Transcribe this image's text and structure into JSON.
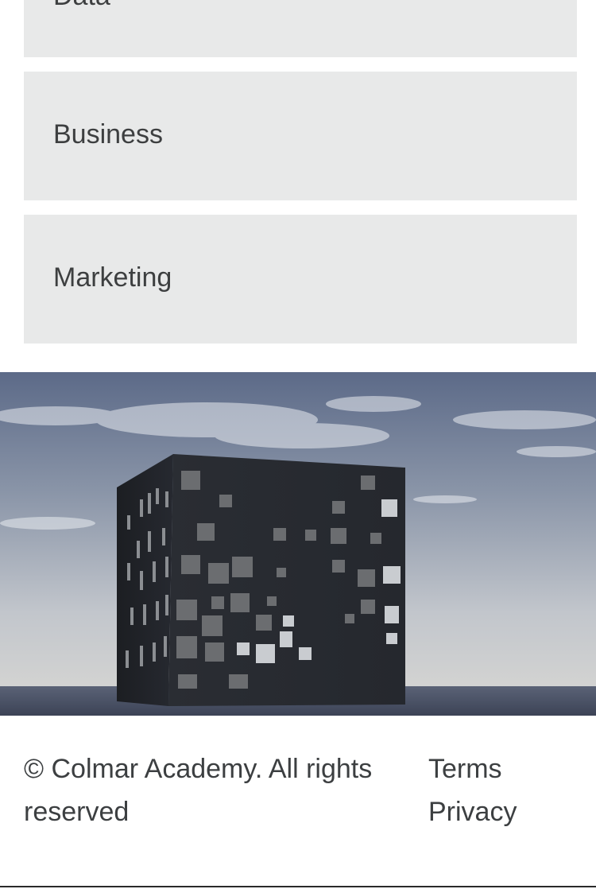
{
  "accordion": {
    "items": [
      {
        "label": "Data"
      },
      {
        "label": "Business"
      },
      {
        "label": "Marketing"
      }
    ]
  },
  "hero": {
    "image": "black-cube-building-photo"
  },
  "footer": {
    "copyright": "© Colmar Academy. All rights reserved",
    "links": [
      {
        "label": "Terms"
      },
      {
        "label": "Privacy"
      }
    ]
  },
  "colors": {
    "panel_bg": "#e8e9e9",
    "text": "#3c3f41"
  }
}
